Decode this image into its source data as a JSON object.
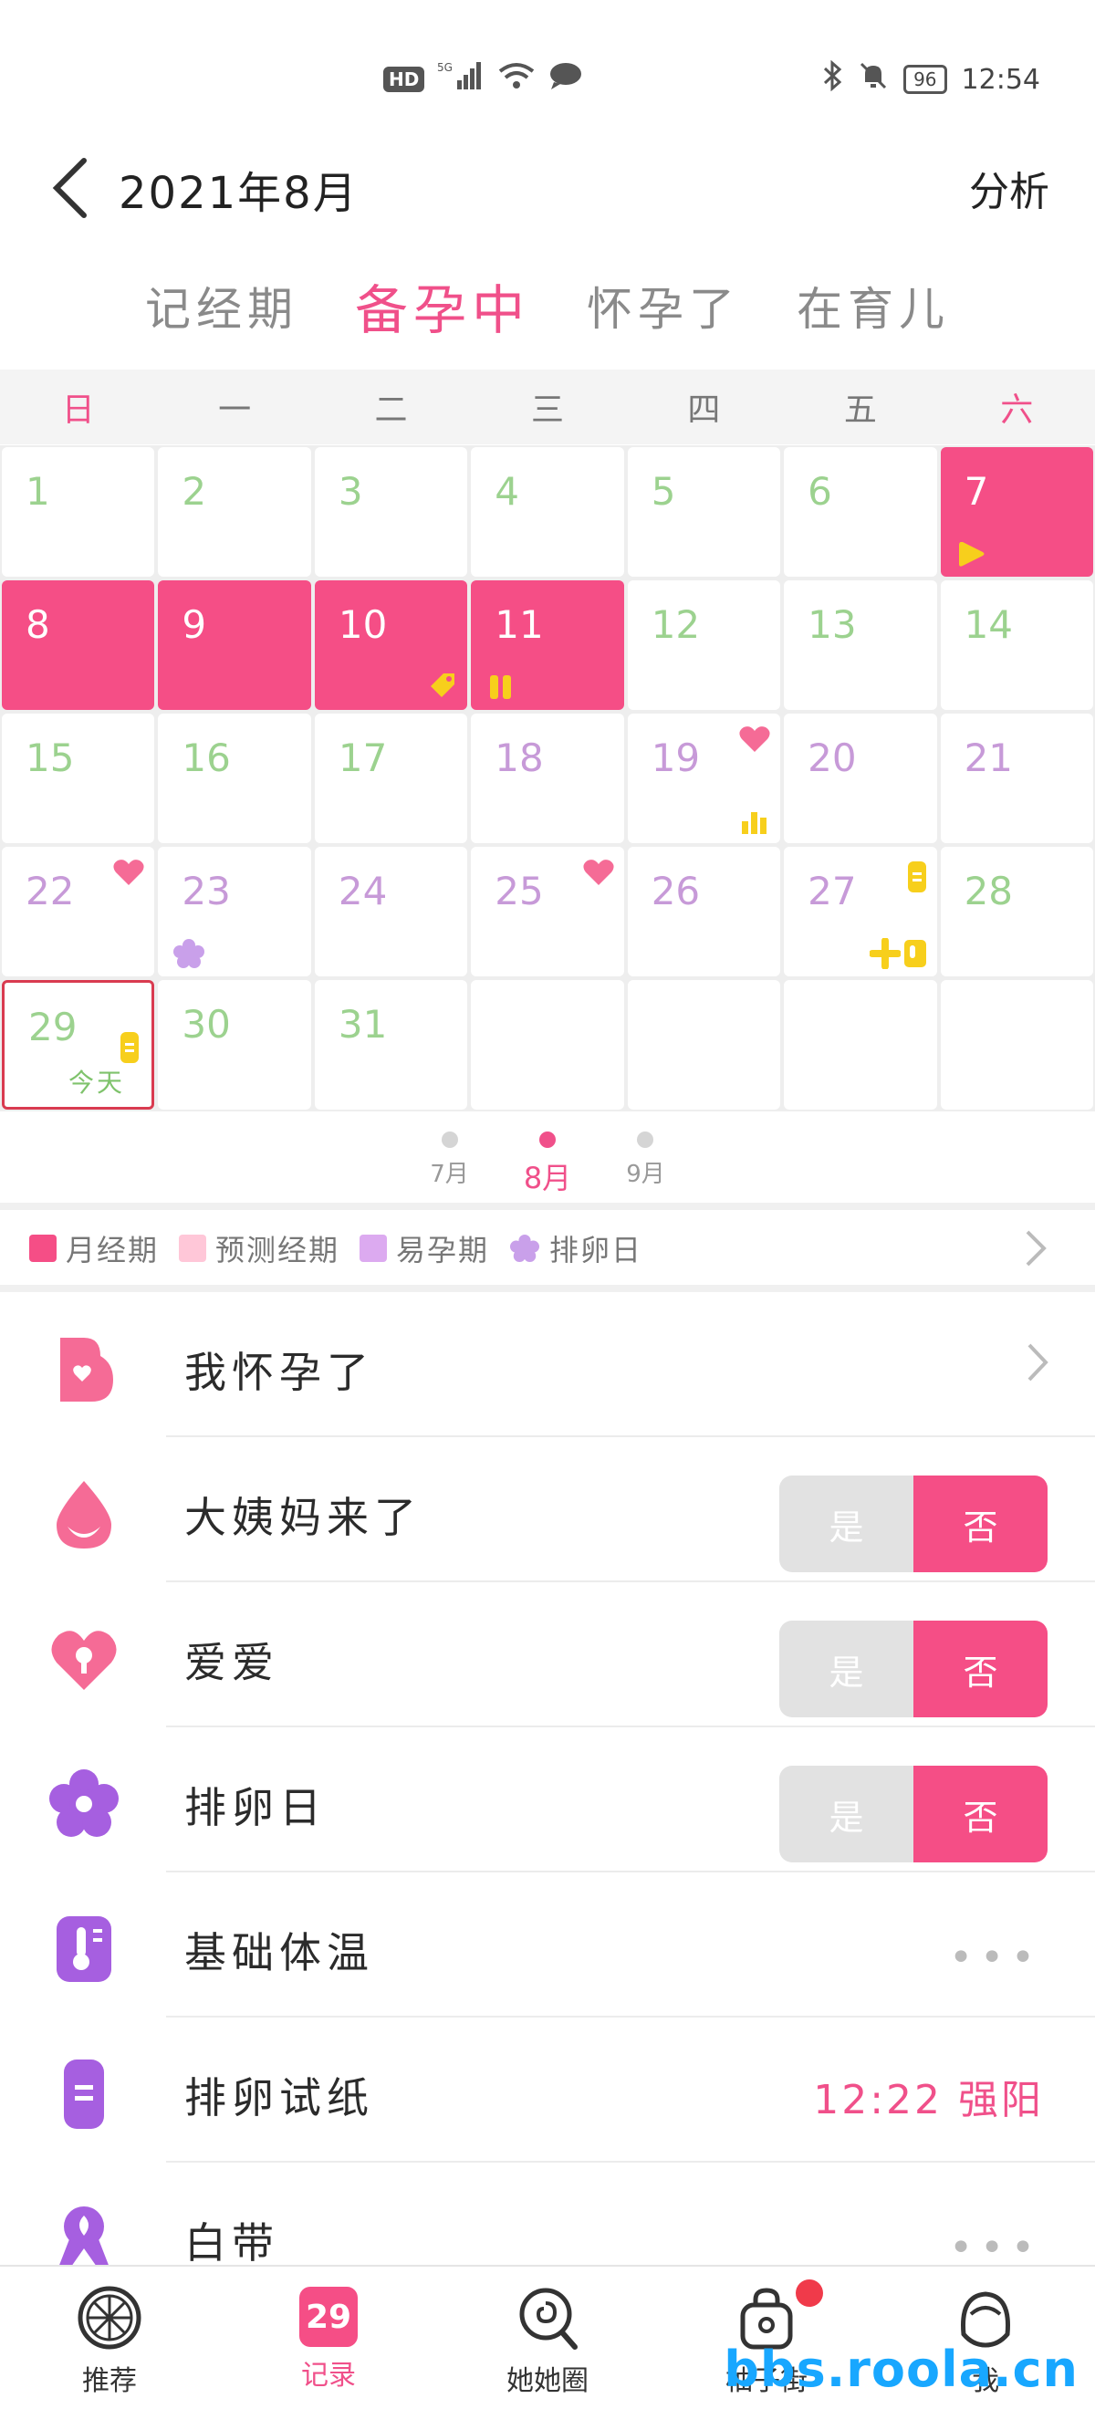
{
  "status_bar": {
    "hd": "HD",
    "net": "5G",
    "battery": "96",
    "time": "12:54"
  },
  "header": {
    "title": "2021年8月",
    "analysis": "分析"
  },
  "mode_tabs": [
    {
      "label": "记经期",
      "active": false
    },
    {
      "label": "备孕中",
      "active": true
    },
    {
      "label": "怀孕了",
      "active": false
    },
    {
      "label": "在育儿",
      "active": false
    }
  ],
  "weekdays": [
    "日",
    "一",
    "二",
    "三",
    "四",
    "五",
    "六"
  ],
  "calendar": {
    "days": [
      {
        "n": "",
        "kind": "blank"
      },
      {
        "n": "",
        "kind": "blank"
      },
      {
        "n": "",
        "kind": "blank"
      },
      {
        "n": "",
        "kind": "blank"
      },
      {
        "n": "",
        "kind": "blank"
      },
      {
        "n": "",
        "kind": "blank"
      },
      {
        "n": "7",
        "kind": "period"
      }
    ],
    "today_label": "今天"
  },
  "month_switch": [
    {
      "label": "7月",
      "active": false
    },
    {
      "label": "8月",
      "active": true
    },
    {
      "label": "9月",
      "active": false
    }
  ],
  "legend": [
    {
      "label": "月经期",
      "color": "#f54e86"
    },
    {
      "label": "预测经期",
      "color": "#ffc7d8"
    },
    {
      "label": "易孕期",
      "color": "#dcaaf0"
    },
    {
      "label": "排卵日",
      "color": "#c9a0ea"
    }
  ],
  "records": {
    "pregnant": {
      "label": "我怀孕了"
    },
    "period": {
      "label": "大姨妈来了",
      "yes": "是",
      "no": "否"
    },
    "love": {
      "label": "爱爱",
      "yes": "是",
      "no": "否"
    },
    "ovulation": {
      "label": "排卵日",
      "yes": "是",
      "no": "否"
    },
    "temperature": {
      "label": "基础体温",
      "more": "•••"
    },
    "test_strip": {
      "label": "排卵试纸",
      "value": "12:22 强阳"
    },
    "discharge": {
      "label": "白带",
      "more": "•••"
    }
  },
  "bottom_nav": [
    {
      "label": "推荐"
    },
    {
      "label": "记录",
      "badge": "29"
    },
    {
      "label": "她她圈"
    },
    {
      "label": "柚子街"
    },
    {
      "label": "我"
    }
  ],
  "watermark": "bbs.roola.cn",
  "colors": {
    "accent": "#f54e86",
    "green_day": "#9cd28f",
    "lavender_day": "#c79ad8",
    "yellow_mark": "#f7cf1c"
  }
}
